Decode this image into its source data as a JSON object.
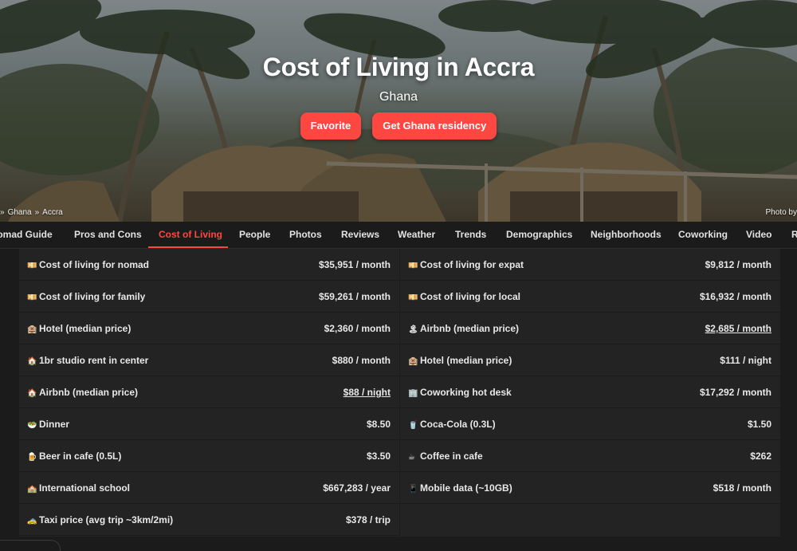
{
  "hero": {
    "title": "Cost of Living in Accra",
    "subtitle": "Ghana",
    "favorite_label": "Favorite",
    "residency_label": "Get Ghana residency",
    "photo_credit": "Photo by"
  },
  "breadcrumb": {
    "items": [
      "Ghana",
      "Accra"
    ],
    "separator": "»"
  },
  "tabs": [
    {
      "label": "Nomad Guide",
      "display": "lomad Guide"
    },
    {
      "label": "Pros and Cons"
    },
    {
      "label": "Cost of Living",
      "active": true
    },
    {
      "label": "People"
    },
    {
      "label": "Photos"
    },
    {
      "label": "Reviews"
    },
    {
      "label": "Weather"
    },
    {
      "label": "Trends"
    },
    {
      "label": "Demographics"
    },
    {
      "label": "Neighborhoods"
    },
    {
      "label": "Coworking"
    },
    {
      "label": "Video"
    },
    {
      "label": "R"
    }
  ],
  "costs": {
    "left": [
      {
        "icon": "💴",
        "icon_name": "money-icon",
        "label": "Cost of living for nomad",
        "value": "$35,951 / month"
      },
      {
        "icon": "💴",
        "icon_name": "money-icon",
        "label": "Cost of living for family",
        "value": "$59,261 / month"
      },
      {
        "icon": "🏨",
        "icon_name": "hotel-icon",
        "label": "Hotel (median price)",
        "value": "$2,360 / month"
      },
      {
        "icon": "🏠",
        "icon_name": "house-icon",
        "label": "1br studio rent in center",
        "value": "$880 / month"
      },
      {
        "icon": "🏠",
        "icon_name": "house-icon",
        "label": "Airbnb (median price)",
        "value": "$88 / night",
        "link": true
      },
      {
        "icon": "🥗",
        "icon_name": "dinner-icon",
        "label": "Dinner",
        "value": "$8.50"
      },
      {
        "icon": "🍺",
        "icon_name": "beer-icon",
        "label": "Beer in cafe (0.5L)",
        "value": "$3.50"
      },
      {
        "icon": "🏫",
        "icon_name": "school-icon",
        "label": "International school",
        "value": "$667,283 / year"
      },
      {
        "icon": "🚕",
        "icon_name": "taxi-icon",
        "label": "Taxi price (avg trip ~3km/2mi)",
        "value": "$378 / trip"
      }
    ],
    "right": [
      {
        "icon": "💴",
        "icon_name": "money-icon",
        "label": "Cost of living for expat",
        "value": "$9,812 / month"
      },
      {
        "icon": "💴",
        "icon_name": "money-icon",
        "label": "Cost of living for local",
        "value": "$16,932 / month"
      },
      {
        "icon": "🏝",
        "icon_name": "airbnb-icon",
        "label": "Airbnb (median price)",
        "value": "$2,685 / month",
        "link": true
      },
      {
        "icon": "🏨",
        "icon_name": "hotel-icon",
        "label": "Hotel (median price)",
        "value": "$111 / night"
      },
      {
        "icon": "🏢",
        "icon_name": "office-icon",
        "label": "Coworking hot desk",
        "value": "$17,292 / month"
      },
      {
        "icon": "🥤",
        "icon_name": "cola-icon",
        "label": "Coca-Cola (0.3L)",
        "value": "$1.50"
      },
      {
        "icon": "☕",
        "icon_name": "coffee-icon",
        "label": "Coffee in cafe",
        "value": "$262"
      },
      {
        "icon": "📱",
        "icon_name": "phone-icon",
        "label": "Mobile data (~10GB)",
        "value": "$518 / month"
      }
    ]
  },
  "colors": {
    "accent": "#ff4742",
    "background": "#1b1b1b",
    "row": "#232323",
    "text": "#e8e8e8"
  }
}
